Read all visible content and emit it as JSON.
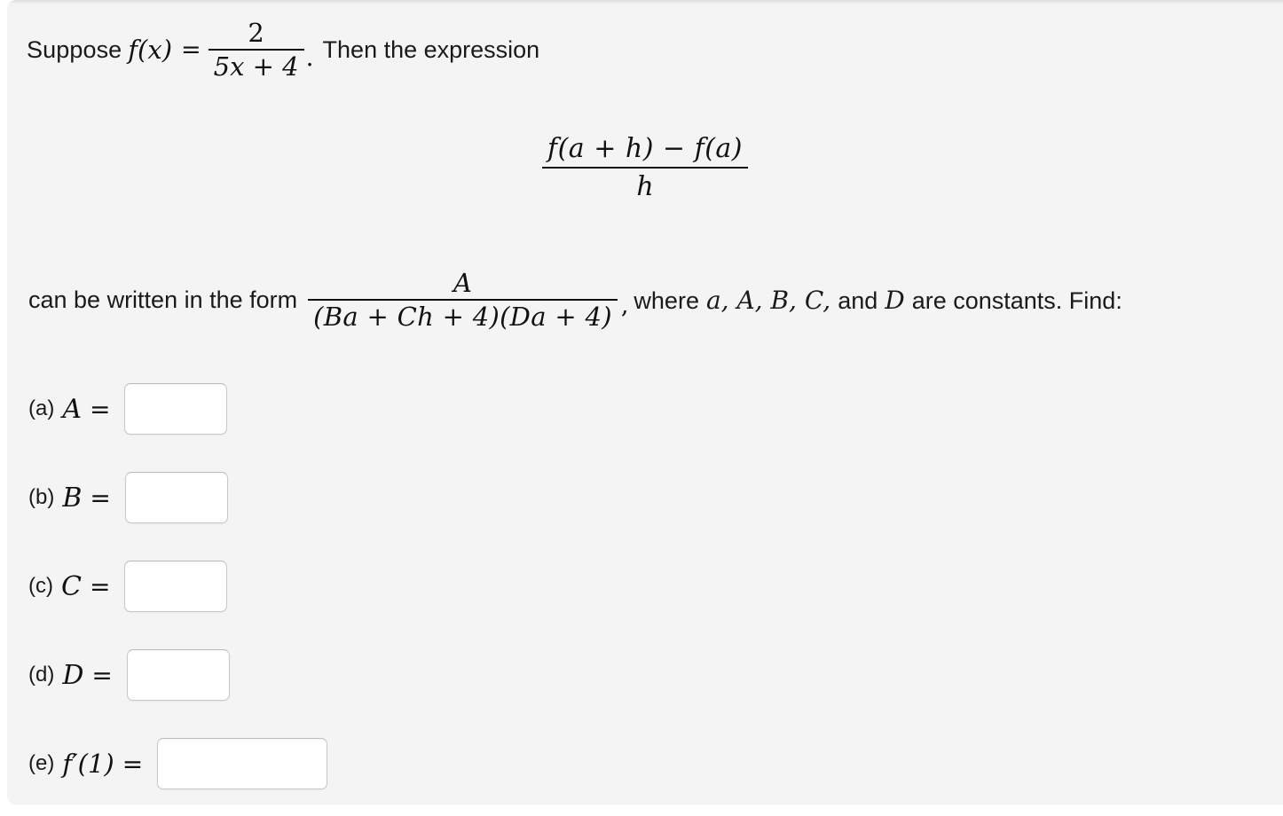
{
  "problem": {
    "line1": {
      "lead": "Suppose",
      "function_name": "f(x)",
      "equals": "=",
      "fraction": {
        "numerator": "2",
        "denominator": "5x + 4"
      },
      "period": ".",
      "tail": "Then the expression"
    },
    "line2": {
      "fraction": {
        "numerator": "f(a + h) − f(a)",
        "denominator": "h"
      }
    },
    "line3": {
      "lead": "can be written in the form",
      "fraction": {
        "numerator": "A",
        "denominator": "(Ba + Ch + 4)(Da + 4)"
      },
      "comma": ",",
      "where": "where",
      "constants_list": "a, A, B, C,",
      "and": "and",
      "last_constant": "D",
      "tail": "are constants. Find:"
    }
  },
  "answers": [
    {
      "tag": "(a)",
      "symbol": "A",
      "equals": "=",
      "value": "",
      "placeholder": ""
    },
    {
      "tag": "(b)",
      "symbol": "B",
      "equals": "=",
      "value": "",
      "placeholder": ""
    },
    {
      "tag": "(c)",
      "symbol": "C",
      "equals": "=",
      "value": "",
      "placeholder": ""
    },
    {
      "tag": "(d)",
      "symbol": "D",
      "equals": "=",
      "value": "",
      "placeholder": ""
    },
    {
      "tag": "(e)",
      "symbol": "f′(1)",
      "equals": "=",
      "value": "",
      "placeholder": ""
    }
  ],
  "colors": {
    "panel_background": "#f4f4f4",
    "page_background": "#ffffff",
    "text": "#111111",
    "input_background": "#ffffff",
    "input_border": "#c9c9c9"
  }
}
